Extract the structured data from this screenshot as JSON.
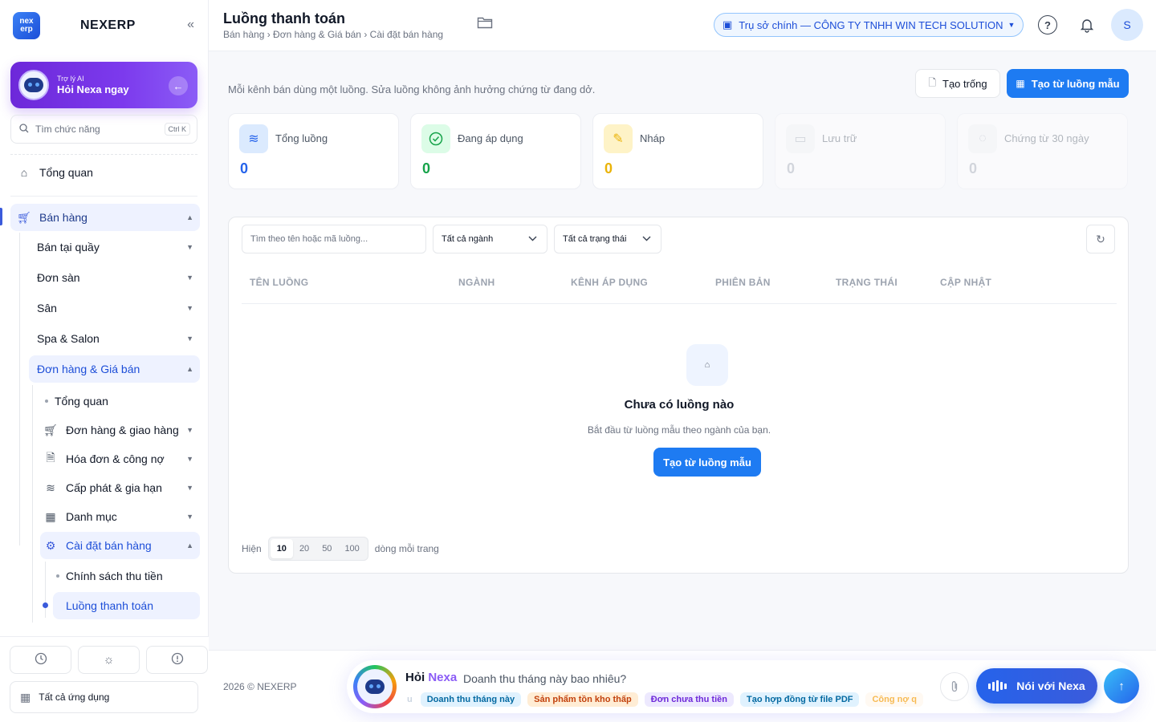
{
  "app": {
    "brand": "NEXERP",
    "logo_top": "nex",
    "logo_bottom": "erp"
  },
  "sidebar": {
    "ai_card": {
      "subtitle": "Trợ lý AI",
      "title": "Hỏi Nexa ngay"
    },
    "search": {
      "placeholder": "Tìm chức năng",
      "shortcut": "Ctrl K"
    },
    "overview": "Tổng quan",
    "sales_group": "Bán hàng",
    "sales_items": [
      "Bán tại quầy",
      "Đơn sàn",
      "Sân",
      "Spa & Salon"
    ],
    "orders_pricing": "Đơn hàng & Giá bán",
    "sub_overview": "Tổng quan",
    "sub_items": [
      "Đơn hàng & giao hàng",
      "Hóa đơn & công nợ",
      "Cấp phát & gia hạn",
      "Danh mục"
    ],
    "sales_settings": "Cài đặt bán hàng",
    "settings_items": [
      "Chính sách thu tiền",
      "Luồng thanh toán"
    ],
    "all_apps": "Tất cả ứng dụng"
  },
  "header": {
    "title": "Luồng thanh toán",
    "breadcrumb": "Bán hàng › Đơn hàng & Giá bán › Cài đặt bán hàng",
    "branch": "Trụ sở chính — CÔNG TY TNHH WIN TECH SOLUTION",
    "help": "?",
    "user_initial": "S"
  },
  "main": {
    "hint": "Mỗi kênh bán dùng một luồng. Sửa luồng không ảnh hưởng chứng từ đang dở.",
    "btn_blank": "Tạo trống",
    "btn_template": "Tạo từ luồng mẫu",
    "stats": [
      {
        "label": "Tổng luồng",
        "value": "0",
        "color": "#2563eb",
        "bg": "#dbeafe",
        "icon": "layers-icon"
      },
      {
        "label": "Đang áp dụng",
        "value": "0",
        "color": "#16a34a",
        "bg": "#dcfce7",
        "icon": "check-circle-icon"
      },
      {
        "label": "Nháp",
        "value": "0",
        "color": "#eab308",
        "bg": "#fef3c7",
        "icon": "draft-icon"
      },
      {
        "label": "Lưu trữ",
        "value": "0",
        "color": "#9ca3af",
        "bg": "#f3f4f6",
        "icon": "archive-icon"
      },
      {
        "label": "Chứng từ 30 ngày",
        "value": "0",
        "color": "#9ca3af",
        "bg": "#f3f4f6",
        "icon": "document-icon"
      }
    ],
    "filters": {
      "search_placeholder": "Tìm theo tên hoặc mã luồng...",
      "industry": "Tất cả ngành",
      "status": "Tất cả trạng thái"
    },
    "columns": [
      "TÊN LUỒNG",
      "NGÀNH",
      "KÊNH ÁP DỤNG",
      "PHIÊN BẢN",
      "TRẠNG THÁI",
      "CẬP NHẬT"
    ],
    "empty": {
      "title": "Chưa có luồng nào",
      "subtitle": "Bắt đầu từ luồng mẫu theo ngành của bạn.",
      "button": "Tạo từ luồng mẫu"
    },
    "pager": {
      "prefix": "Hiện",
      "sizes": [
        "10",
        "20",
        "50",
        "100"
      ],
      "selected": "10",
      "suffix": "dòng mỗi trang"
    }
  },
  "footer": {
    "copyright": "2026 © NEXERP",
    "ask": {
      "title_a": "Hỏi",
      "title_b": "Nexa",
      "prompt": "Doanh thu tháng này bao nhiêu?",
      "chip_fade": "u",
      "chips": [
        "Doanh thu tháng này",
        "Sản phẩm tồn kho thấp",
        "Đơn chưa thu tiền",
        "Tạo hợp đồng từ file PDF",
        "Công nợ q"
      ],
      "voice": "Nói với Nexa"
    }
  }
}
